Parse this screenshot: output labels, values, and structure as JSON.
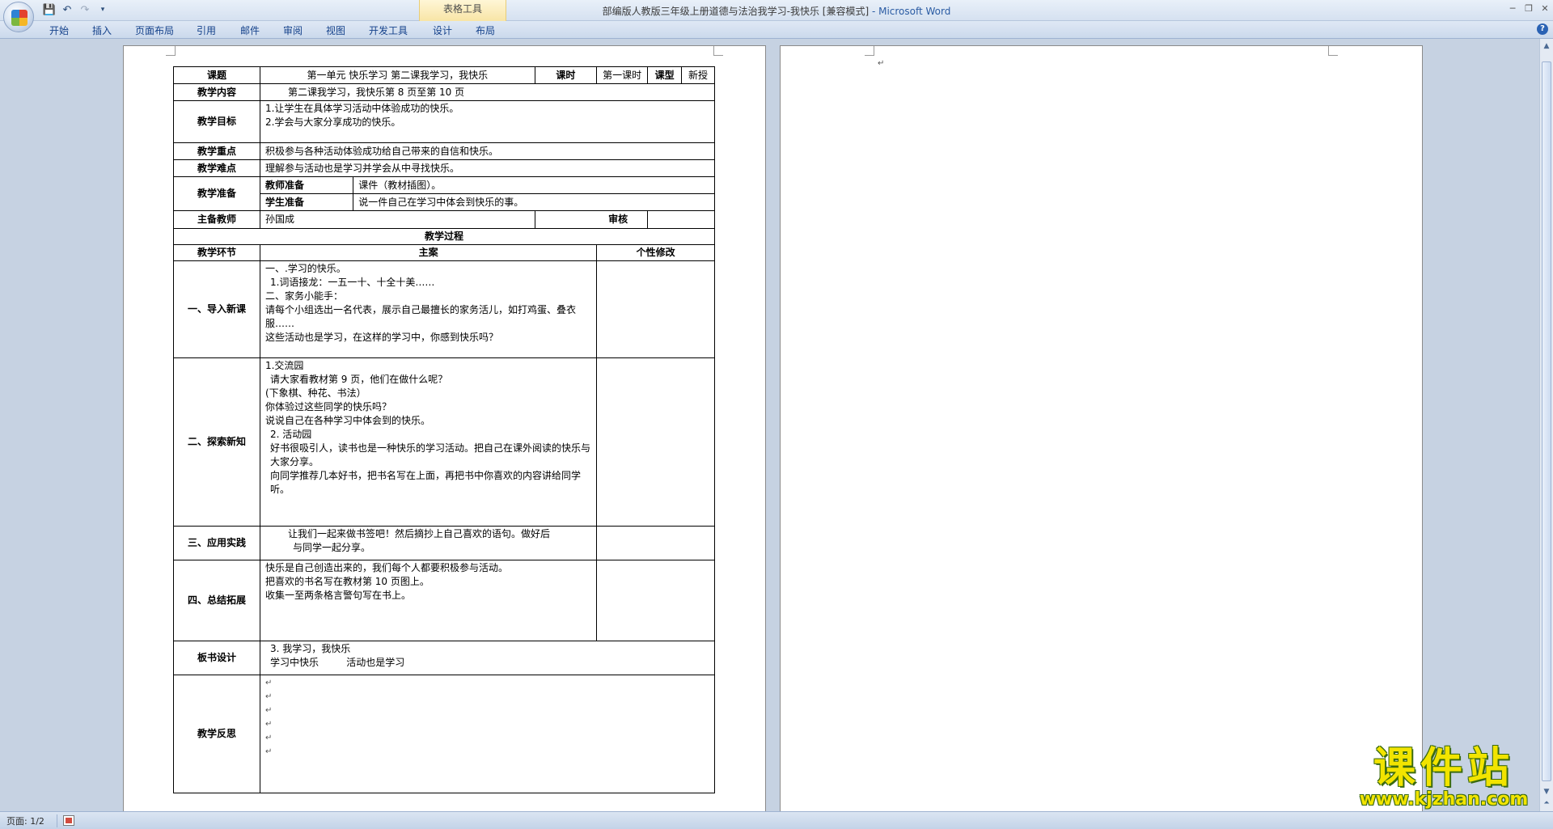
{
  "window": {
    "title": "部编版人教版三年级上册道德与法治我学习-我快乐 [兼容模式]",
    "app_name": "- Microsoft Word",
    "table_tools_label": "表格工具"
  },
  "quick_access": {
    "save_icon": "save-icon",
    "undo_icon": "undo-icon",
    "redo_icon": "redo-icon",
    "customize_icon": "dropdown-icon"
  },
  "ribbon": {
    "tabs": [
      "开始",
      "插入",
      "页面布局",
      "引用",
      "邮件",
      "审阅",
      "视图",
      "开发工具",
      "设计",
      "布局"
    ]
  },
  "status_bar": {
    "page": "页面: 1/2"
  },
  "lesson": {
    "topic_label": "课题",
    "topic_value": "第一单元  快乐学习  第二课我学习，我快乐",
    "period_label": "课时",
    "period_value": "第一课时",
    "type_label": "课型",
    "type_value": "新授",
    "content_label": "教学内容",
    "content_value": "第二课我学习，我快乐第 8 页至第 10 页",
    "goal_label": "教学目标",
    "goals": [
      "1.让学生在具体学习活动中体验成功的快乐。",
      "2.学会与大家分享成功的快乐。"
    ],
    "key_label": "教学重点",
    "key_value": "积极参与各种活动体验成功给自己带来的自信和快乐。",
    "difficulty_label": "教学难点",
    "difficulty_value": "理解参与活动也是学习并学会从中寻找快乐。",
    "prep_label": "教学准备",
    "teacher_prep_label": "教师准备",
    "teacher_prep_value": "课件（教材插图）。",
    "student_prep_label": "学生准备",
    "student_prep_value": "说一件自己在学习中体会到快乐的事。",
    "main_teacher_label": "主备教师",
    "main_teacher_value": "孙国成",
    "review_label": "审核",
    "process_title": "教学过程",
    "col_stage": "教学环节",
    "col_main": "主案",
    "col_personal": "个性修改",
    "stage1_label": "一、导入新课",
    "stage1_lines": [
      "一、.学习的快乐。",
      "1.词语接龙：一五一十、十全十美……",
      "二、家务小能手：",
      "请每个小组选出一名代表，展示自己最擅长的家务活儿，如打鸡蛋、叠衣服……",
      "这些活动也是学习，在这样的学习中，你感到快乐吗？"
    ],
    "stage2_label": "二、探索新知",
    "stage2_lines": [
      "1.交流园",
      "请大家看教材第 9 页，他们在做什么呢？",
      "(下象棋、种花、书法）",
      "你体验过这些同学的快乐吗？",
      "说说自己在各种学习中体会到的快乐。",
      "2. 活动园",
      "好书很吸引人，读书也是一种快乐的学习活动。把自己在课外阅读的快乐与大家分享。",
      "向同学推荐几本好书，把书名写在上面，再把书中你喜欢的内容讲给同学听。"
    ],
    "stage3_label": "三、应用实践",
    "stage3_lines": [
      "让我们一起来做书签吧！然后摘抄上自己喜欢的语句。做好后",
      "与同学一起分享。"
    ],
    "stage4_label": "四、总结拓展",
    "stage4_lines": [
      "快乐是自己创造出来的，我们每个人都要积极参与活动。",
      "把喜欢的书名写在教材第 10 页图上。",
      "收集一至两条格言警句写在书上。"
    ],
    "board_label": "板书设计",
    "board_lines": [
      "3. 我学习，我快乐",
      "学习中快乐         活动也是学习"
    ],
    "reflection_label": "教学反思"
  },
  "watermark": {
    "title": "课件站",
    "url": "www.kjzhan.com"
  },
  "colors": {
    "workspace": "#c6d2e2",
    "ribbon_text": "#15428b",
    "watermark_fill": "#f2e400",
    "watermark_outline": "#3a6a10"
  }
}
